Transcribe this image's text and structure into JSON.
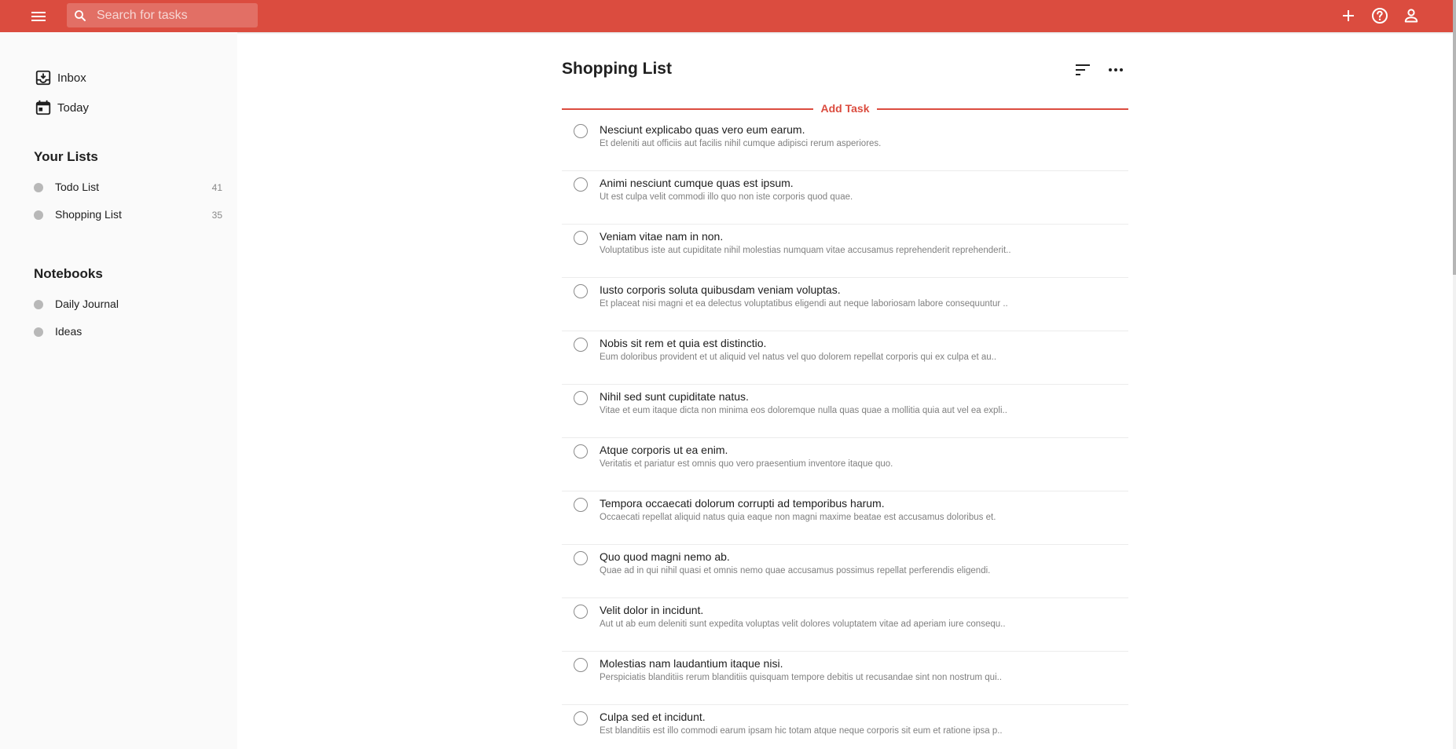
{
  "colors": {
    "accent": "#db4c3f",
    "dot": "#b8b8b8"
  },
  "search": {
    "placeholder": "Search for tasks"
  },
  "sidebar": {
    "nav": [
      {
        "label": "Inbox",
        "icon": "inbox-icon"
      },
      {
        "label": "Today",
        "icon": "calendar-icon"
      }
    ],
    "lists_title": "Your Lists",
    "lists": [
      {
        "label": "Todo List",
        "count": "41"
      },
      {
        "label": "Shopping List",
        "count": "35"
      }
    ],
    "notebooks_title": "Notebooks",
    "notebooks": [
      {
        "label": "Daily Journal"
      },
      {
        "label": "Ideas"
      }
    ]
  },
  "main": {
    "title": "Shopping List",
    "add_task_label": "Add Task",
    "tasks": [
      {
        "title": "Nesciunt explicabo quas vero eum earum.",
        "description": "Et deleniti aut officiis aut facilis nihil cumque adipisci rerum asperiores."
      },
      {
        "title": "Animi nesciunt cumque quas est ipsum.",
        "description": "Ut est culpa velit commodi illo quo non iste corporis quod quae."
      },
      {
        "title": "Veniam vitae nam in non.",
        "description": "Voluptatibus iste aut cupiditate nihil molestias numquam vitae accusamus reprehenderit reprehenderit.."
      },
      {
        "title": "Iusto corporis soluta quibusdam veniam voluptas.",
        "description": "Et placeat nisi magni et ea delectus voluptatibus eligendi aut neque laboriosam labore consequuntur .."
      },
      {
        "title": "Nobis sit rem et quia est distinctio.",
        "description": "Eum doloribus provident et ut aliquid vel natus vel quo dolorem repellat corporis qui ex culpa et au.."
      },
      {
        "title": "Nihil sed sunt cupiditate natus.",
        "description": "Vitae et eum itaque dicta non minima eos doloremque nulla quas quae a mollitia quia aut vel ea expli.."
      },
      {
        "title": "Atque corporis ut ea enim.",
        "description": "Veritatis et pariatur est omnis quo vero praesentium inventore itaque quo."
      },
      {
        "title": "Tempora occaecati dolorum corrupti ad temporibus harum.",
        "description": "Occaecati repellat aliquid natus quia eaque non magni maxime beatae est accusamus doloribus et."
      },
      {
        "title": "Quo quod magni nemo ab.",
        "description": "Quae ad in qui nihil quasi et omnis nemo quae accusamus possimus repellat perferendis eligendi."
      },
      {
        "title": "Velit dolor in incidunt.",
        "description": "Aut ut ab eum deleniti sunt expedita voluptas velit dolores voluptatem vitae ad aperiam iure consequ.."
      },
      {
        "title": "Molestias nam laudantium itaque nisi.",
        "description": "Perspiciatis blanditiis rerum blanditiis quisquam tempore debitis ut recusandae sint non nostrum qui.."
      },
      {
        "title": "Culpa sed et incidunt.",
        "description": "Est blanditiis est illo commodi earum ipsam hic totam atque neque corporis sit eum et ratione ipsa p.."
      }
    ]
  }
}
